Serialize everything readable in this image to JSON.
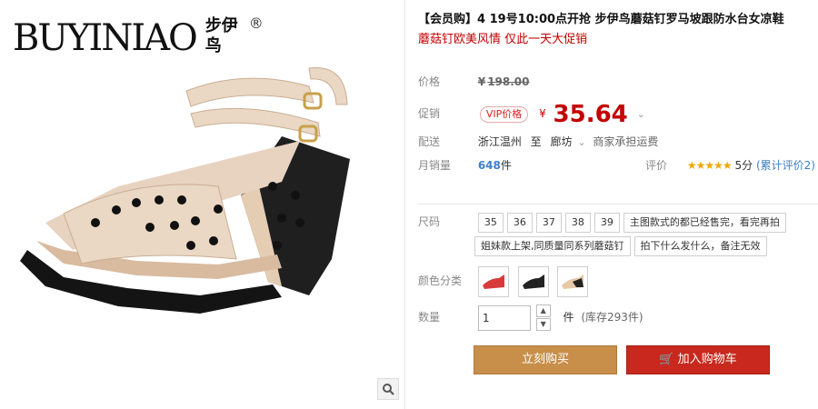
{
  "brand": {
    "latin": "BUYINIAO",
    "chinese": "步伊鸟",
    "reg": "®"
  },
  "product": {
    "title": "【会员购】4 19号10:00点开抢 步伊鸟蘑菇钉罗马坡跟防水台女凉鞋",
    "promo": "蘑菇钉欧美风情 仅此一天大促销"
  },
  "price": {
    "label": "价格",
    "currency": "¥",
    "original": "198.00"
  },
  "promo_price": {
    "label": "促销",
    "vip_badge": "VIP价格",
    "currency": "¥",
    "value": "35.64"
  },
  "delivery": {
    "label": "配送",
    "from": "浙江温州",
    "to_word": "至",
    "to": "廊坊",
    "freight": "商家承担运费"
  },
  "sales": {
    "label": "月销量",
    "count": "648",
    "unit": "件",
    "rating_label": "评价",
    "stars": "★★★★★",
    "score": "5分",
    "reviews": "(累计评价2)"
  },
  "size": {
    "label": "尺码",
    "options": [
      "35",
      "36",
      "37",
      "38",
      "39"
    ],
    "notes": [
      "主图款式的都已经售完，看完再拍",
      "姐妹款上架,同质量同系列蘑菇钉",
      "拍下什么发什么，备注无效"
    ]
  },
  "color": {
    "label": "颜色分类",
    "options": [
      "#d93b3b",
      "#222222",
      "#e6c9a8"
    ]
  },
  "quantity": {
    "label": "数量",
    "value": "1",
    "unit": "件",
    "stock": "(库存293件)"
  },
  "actions": {
    "buy_now": "立刻购买",
    "add_cart": "加入购物车"
  },
  "colors": {
    "accent_red": "#c40000",
    "buy_button": "#c88f4a",
    "cart_button": "#c8281e"
  }
}
